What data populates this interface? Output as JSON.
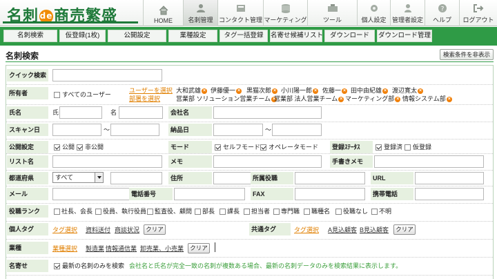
{
  "app": {
    "logo_part1": "名刺",
    "logo_de": "de",
    "logo_part2": "商売繁盛"
  },
  "nav": [
    {
      "label": "HOME",
      "icon": "home-icon"
    },
    {
      "label": "名刺管理",
      "icon": "user-card-icon"
    },
    {
      "label": "コンタクト管理",
      "icon": "contact-icon"
    },
    {
      "label": "マーケティング",
      "icon": "marketing-icon"
    },
    {
      "label": "ツール",
      "icon": "tool-icon"
    },
    {
      "label": "個人設定",
      "icon": "gear-icon"
    },
    {
      "label": "管理者設定",
      "icon": "admin-icon"
    },
    {
      "label": "ヘルプ",
      "icon": "help-icon"
    },
    {
      "label": "ログアウト",
      "icon": "logout-icon"
    }
  ],
  "tabs": [
    "名刺検索",
    "仮登録(1枚)",
    "公開設定",
    "業種設定",
    "タグ一括登録",
    "名寄せ候補リスト",
    "ダウンロード",
    "ダウンロード管理"
  ],
  "page": {
    "title": "名刺検索",
    "hide_conditions": "検索条件を非表示"
  },
  "form": {
    "quick_search": {
      "label": "クイック検索",
      "value": ""
    },
    "owner": {
      "label": "所有者",
      "all_users": "すべてのユーザー",
      "select_user": "ユーザーを選択",
      "select_dept": "部署を選択",
      "users": [
        "大和武雄",
        "伊藤優一",
        "黒猫次郎",
        "小川陽一郎",
        "佐藤一",
        "田中由紀雄",
        "渡辺寛太"
      ],
      "depts": [
        "営業部 ソリューション営業チーム",
        "営業部 法人営業チーム",
        "マーケティング部",
        "情報システム部"
      ]
    },
    "name": {
      "label": "氏名",
      "last": "氏",
      "first": "名"
    },
    "company": {
      "label": "会社名"
    },
    "scan_date": {
      "label": "スキャン日",
      "sep": "〜"
    },
    "delivery_date": {
      "label": "納品日",
      "sep": "〜"
    },
    "publish": {
      "label": "公開設定",
      "public": "公開",
      "private": "非公開",
      "public_checked": true,
      "private_checked": true
    },
    "mode": {
      "label": "モード",
      "self": "セルフモード",
      "operator": "オペレータモード",
      "self_checked": true,
      "operator_checked": true
    },
    "reg_status": {
      "label": "登録ｽﾃｰﾀｽ",
      "done": "登録済",
      "temp": "仮登録",
      "done_checked": true,
      "temp_checked": false
    },
    "list_name": {
      "label": "リスト名"
    },
    "memo": {
      "label": "メモ"
    },
    "handwritten": {
      "label": "手書きメモ"
    },
    "prefecture": {
      "label": "都道府県",
      "selected": "すべて"
    },
    "address": {
      "label": "住所"
    },
    "position": {
      "label": "所属役職"
    },
    "url": {
      "label": "URL"
    },
    "email": {
      "label": "メール"
    },
    "phone": {
      "label": "電話番号"
    },
    "fax": {
      "label": "FAX"
    },
    "mobile": {
      "label": "携帯電話"
    },
    "rank": {
      "label": "役職ランク",
      "options": [
        "社長、会長",
        "役員、執行役員",
        "監査役、顧問",
        "部長",
        "課長",
        "担当者",
        "専門職",
        "職種名",
        "役職なし",
        "不明"
      ]
    },
    "personal_tag": {
      "label": "個人タグ",
      "select": "タグ選択",
      "tags": [
        "資料送付",
        "商談状況"
      ],
      "clear": "クリア"
    },
    "shared_tag": {
      "label": "共通タグ",
      "select": "タグ選択",
      "tags": [
        "A見込顧客",
        "B見込顧客"
      ],
      "clear": "クリア"
    },
    "industry": {
      "label": "業種",
      "select": "業種選択",
      "items": [
        "製造業",
        "情報通信業",
        "卸売業、小売業"
      ],
      "clear": "クリア"
    },
    "dedupe": {
      "label": "名寄せ",
      "latest_only": "最新の名刺のみを検索",
      "latest_checked": true,
      "note": "会社名と氏名が完全一致の名刺が複数ある場合、最新の名刺データのみを検索結果に表示します。"
    }
  },
  "colors": {
    "brand_green": "#2f9b46",
    "accent_orange": "#e07f00",
    "label_bg": "#e6f0e0"
  }
}
